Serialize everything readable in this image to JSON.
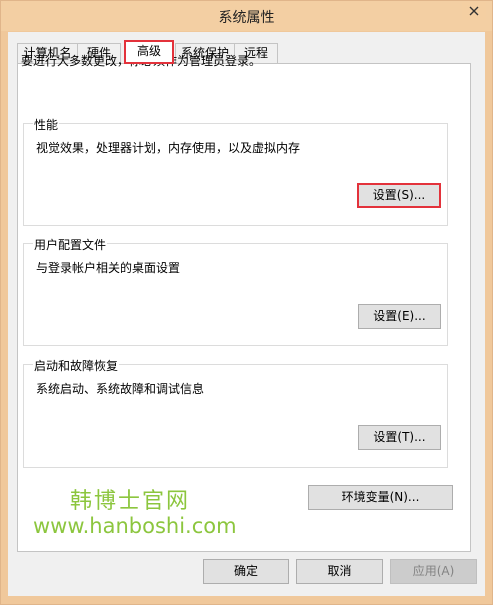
{
  "window": {
    "title": "系统属性"
  },
  "tabs": [
    {
      "label": "计算机名",
      "active": false
    },
    {
      "label": "硬件",
      "active": false
    },
    {
      "label": "高级",
      "active": true
    },
    {
      "label": "系统保护",
      "active": false
    },
    {
      "label": "远程",
      "active": false
    }
  ],
  "intro": "要进行大多数更改，你必须作为管理员登录。",
  "performance": {
    "title": "性能",
    "description": "视觉效果，处理器计划，内存使用，以及虚拟内存",
    "settings_label": "设置(S)..."
  },
  "user_profiles": {
    "title": "用户配置文件",
    "description": "与登录帐户相关的桌面设置",
    "settings_label": "设置(E)..."
  },
  "startup_recovery": {
    "title": "启动和故障恢复",
    "description": "系统启动、系统故障和调试信息",
    "settings_label": "设置(T)..."
  },
  "env_vars_label": "环境变量(N)...",
  "watermark": {
    "name": "韩博士官网",
    "url": "www.hanboshi.com"
  },
  "footer": {
    "ok_label": "确定",
    "cancel_label": "取消",
    "apply_label": "应用(A)"
  },
  "colors": {
    "highlight": "#e3323b",
    "title_bar": "#f3cfa3",
    "watermark": "#8cc63e"
  }
}
